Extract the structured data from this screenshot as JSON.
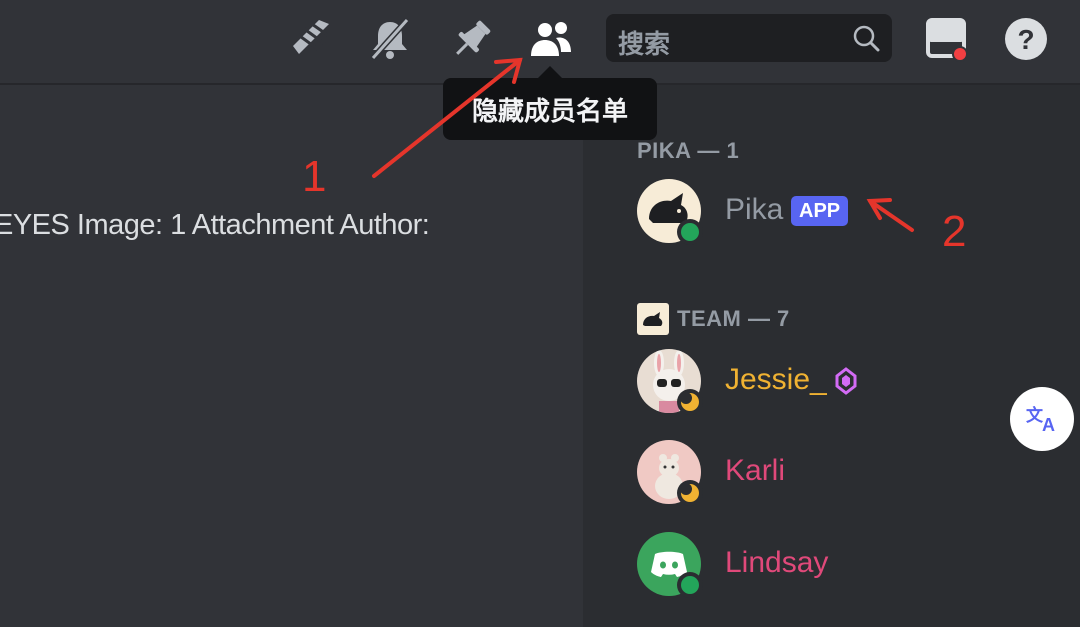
{
  "topbar": {
    "icons": [
      "threads-icon",
      "notification-muted-icon",
      "pin-icon",
      "member-list-icon"
    ],
    "search_placeholder": "搜索",
    "inbox_icon": "inbox-icon",
    "help_icon": "help-icon"
  },
  "tooltip": {
    "label": "隐藏成员名单"
  },
  "chat": {
    "message_text": "EYES  Image: 1 Attachment  Author:"
  },
  "members": {
    "groups": [
      {
        "header": "PIKA — 1"
      },
      {
        "header": "TEAM — 7"
      }
    ],
    "items": [
      {
        "name": "Pika",
        "badge": "APP",
        "color": "#949ba4",
        "status": "online"
      },
      {
        "name": "Jessie_",
        "color": "#f0b232",
        "status": "idle"
      },
      {
        "name": "Karli",
        "color": "#e0497a",
        "status": "idle"
      },
      {
        "name": "Lindsay",
        "color": "#e0497a",
        "status": "online"
      }
    ]
  },
  "annotations": {
    "one": "1",
    "two": "2"
  },
  "colors": {
    "background": "#313338",
    "sidebar": "#2b2d31",
    "accent": "#5865f2",
    "online": "#23a55a",
    "idle": "#f0b232",
    "annotation_red": "#e5352b"
  }
}
